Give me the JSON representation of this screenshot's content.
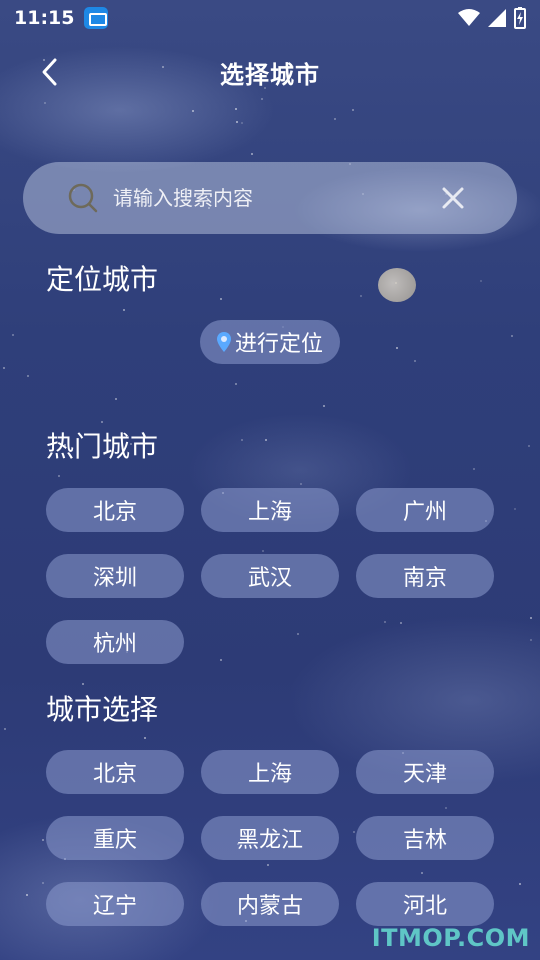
{
  "status_bar": {
    "time": "11:15"
  },
  "header": {
    "title": "选择城市"
  },
  "search": {
    "placeholder": "请输入搜索内容"
  },
  "location_section": {
    "title": "定位城市",
    "locate_label": "进行定位"
  },
  "hot_section": {
    "title": "热门城市",
    "cities": [
      "北京",
      "上海",
      "广州",
      "深圳",
      "武汉",
      "南京",
      "杭州"
    ]
  },
  "select_section": {
    "title": "城市选择",
    "cities": [
      "北京",
      "上海",
      "天津",
      "重庆",
      "黑龙江",
      "吉林",
      "辽宁",
      "内蒙古",
      "河北"
    ]
  },
  "watermark": "ITMOP.COM",
  "colors": {
    "chip_bg": "#8c9bcd",
    "background": "#2f3f7a",
    "pin": "#5aa9ff",
    "watermark": "#5fc6c6"
  }
}
